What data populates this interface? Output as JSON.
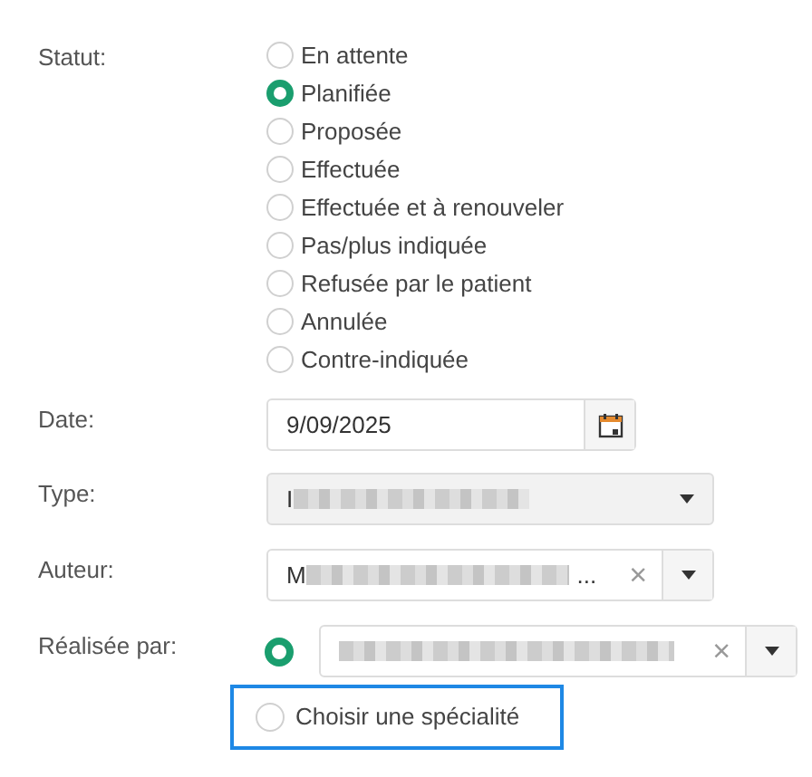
{
  "statut": {
    "label": "Statut:",
    "options": [
      {
        "label": "En attente",
        "selected": false
      },
      {
        "label": "Planifiée",
        "selected": true
      },
      {
        "label": "Proposée",
        "selected": false
      },
      {
        "label": "Effectuée",
        "selected": false
      },
      {
        "label": "Effectuée et à renouveler",
        "selected": false
      },
      {
        "label": "Pas/plus indiquée",
        "selected": false
      },
      {
        "label": "Refusée par le patient",
        "selected": false
      },
      {
        "label": "Annulée",
        "selected": false
      },
      {
        "label": "Contre-indiquée",
        "selected": false
      }
    ]
  },
  "date": {
    "label": "Date:",
    "value": "9/09/2025"
  },
  "type": {
    "label": "Type:",
    "value_start": "I"
  },
  "auteur": {
    "label": "Auteur:",
    "value_start": "M",
    "value_end": "...",
    "clear": "×"
  },
  "realisee_par": {
    "label": "Réalisée par:",
    "options": [
      {
        "kind": "person",
        "selected": true,
        "clear": "×"
      },
      {
        "kind": "specialty",
        "label": "Choisir une spécialité",
        "selected": false,
        "focused": true
      }
    ]
  }
}
